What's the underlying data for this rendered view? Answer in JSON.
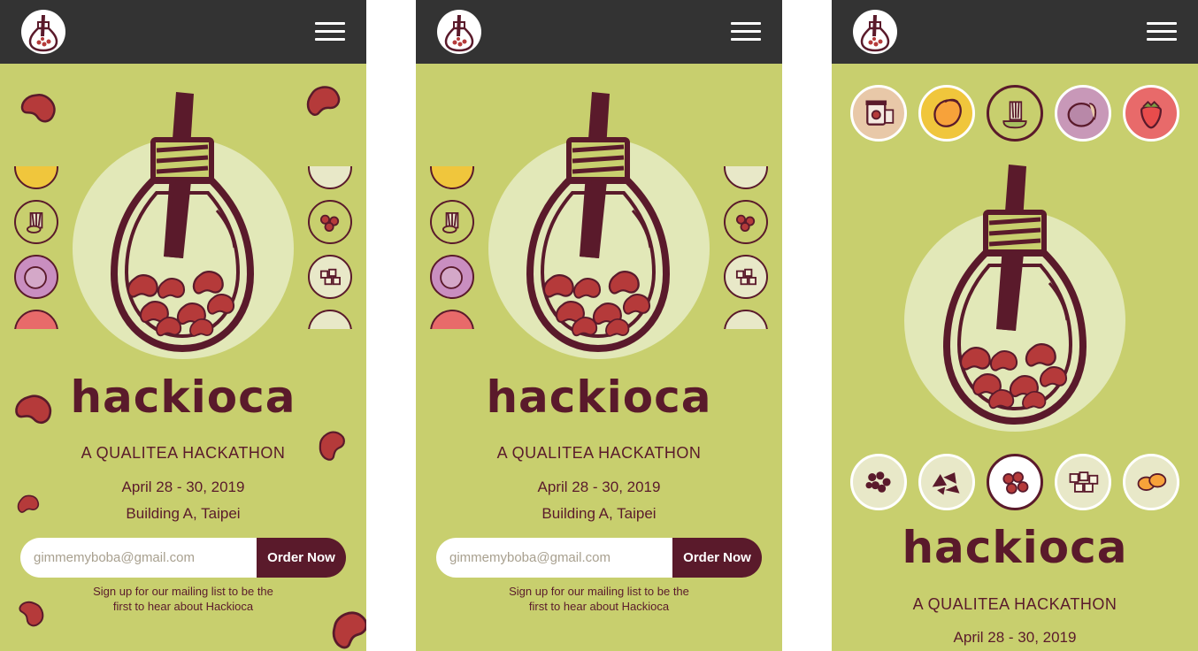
{
  "colors": {
    "background": "#c8cf6e",
    "topbar": "#333333",
    "maroon": "#5a1a2b",
    "bean": "#b53a3a",
    "halo": "#e2e8b8"
  },
  "icons": {
    "logo": "boba-lightbulb-icon",
    "menu": "hamburger-menu-icon",
    "top_flavors": [
      "jam-jar-icon",
      "mango-icon",
      "matcha-whisk-icon",
      "taro-icon",
      "strawberry-icon"
    ],
    "bottom_flavors": [
      "boba-pearls-icon",
      "chocolate-icon",
      "red-bean-icon",
      "coconut-jelly-icon",
      "pudding-icon"
    ]
  },
  "panels": [
    {
      "wordmark": "hackioca",
      "tagline": "A QUALITEA HACKATHON",
      "date": "April  28 - 30, 2019",
      "location": "Building A, Taipei",
      "email_placeholder": "gimmemyboba@gmail.com",
      "cta_label": "Order Now",
      "note_line1": "Sign up for our mailing list to be the",
      "note_line2": "first to hear about Hackioca"
    },
    {
      "wordmark": "hackioca",
      "tagline": "A QUALITEA HACKATHON",
      "date": "April  28 - 30, 2019",
      "location": "Building A, Taipei",
      "email_placeholder": "gimmemyboba@gmail.com",
      "cta_label": "Order Now",
      "note_line1": "Sign up for our mailing list to be the",
      "note_line2": "first to hear about Hackioca"
    },
    {
      "wordmark": "hackioca",
      "tagline": "A QUALITEA HACKATHON",
      "date": "April  28 - 30, 2019"
    }
  ]
}
